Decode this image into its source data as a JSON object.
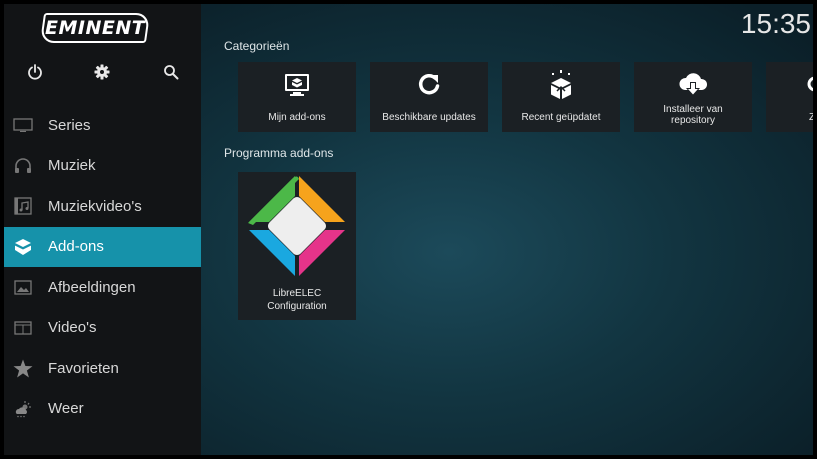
{
  "brand": {
    "logo_text": "EMINENT"
  },
  "clock": "15:35",
  "top_icons": [
    "power-icon",
    "settings-gear-icon",
    "search-icon"
  ],
  "sidebar": {
    "items": [
      {
        "label": "Series",
        "icon": "tv-icon"
      },
      {
        "label": "Muziek",
        "icon": "headphones-icon"
      },
      {
        "label": "Muziekvideo's",
        "icon": "music-video-icon"
      },
      {
        "label": "Add-ons",
        "icon": "addon-box-icon",
        "active": true
      },
      {
        "label": "Afbeeldingen",
        "icon": "picture-icon"
      },
      {
        "label": "Video's",
        "icon": "film-icon"
      },
      {
        "label": "Favorieten",
        "icon": "star-icon"
      },
      {
        "label": "Weer",
        "icon": "weather-icon"
      }
    ]
  },
  "categories": {
    "title": "Categorieën",
    "tiles": [
      {
        "label": "Mijn add-ons",
        "icon": "monitor-box-icon"
      },
      {
        "label": "Beschikbare updates",
        "icon": "refresh-icon"
      },
      {
        "label": "Recent geüpdatet",
        "icon": "box-sparkle-icon"
      },
      {
        "label_line1": "Installeer van",
        "label_line2": "repository",
        "icon": "cloud-download-icon"
      },
      {
        "label": "Zo",
        "icon": "search-icon"
      }
    ]
  },
  "program_addons": {
    "title": "Programma add-ons",
    "items": [
      {
        "label_line1": "LibreELEC",
        "label_line2": "Configuration",
        "icon": "libreelec-logo",
        "colors": {
          "green": "#4cb848",
          "orange": "#f6a31c",
          "blue": "#1aa8e0",
          "pink": "#e5348a",
          "center": "#eeeeee"
        }
      }
    ]
  },
  "colors": {
    "accent": "#1692aa",
    "sidebar_bg": "#121416",
    "tile_bg": "#1b2024"
  }
}
